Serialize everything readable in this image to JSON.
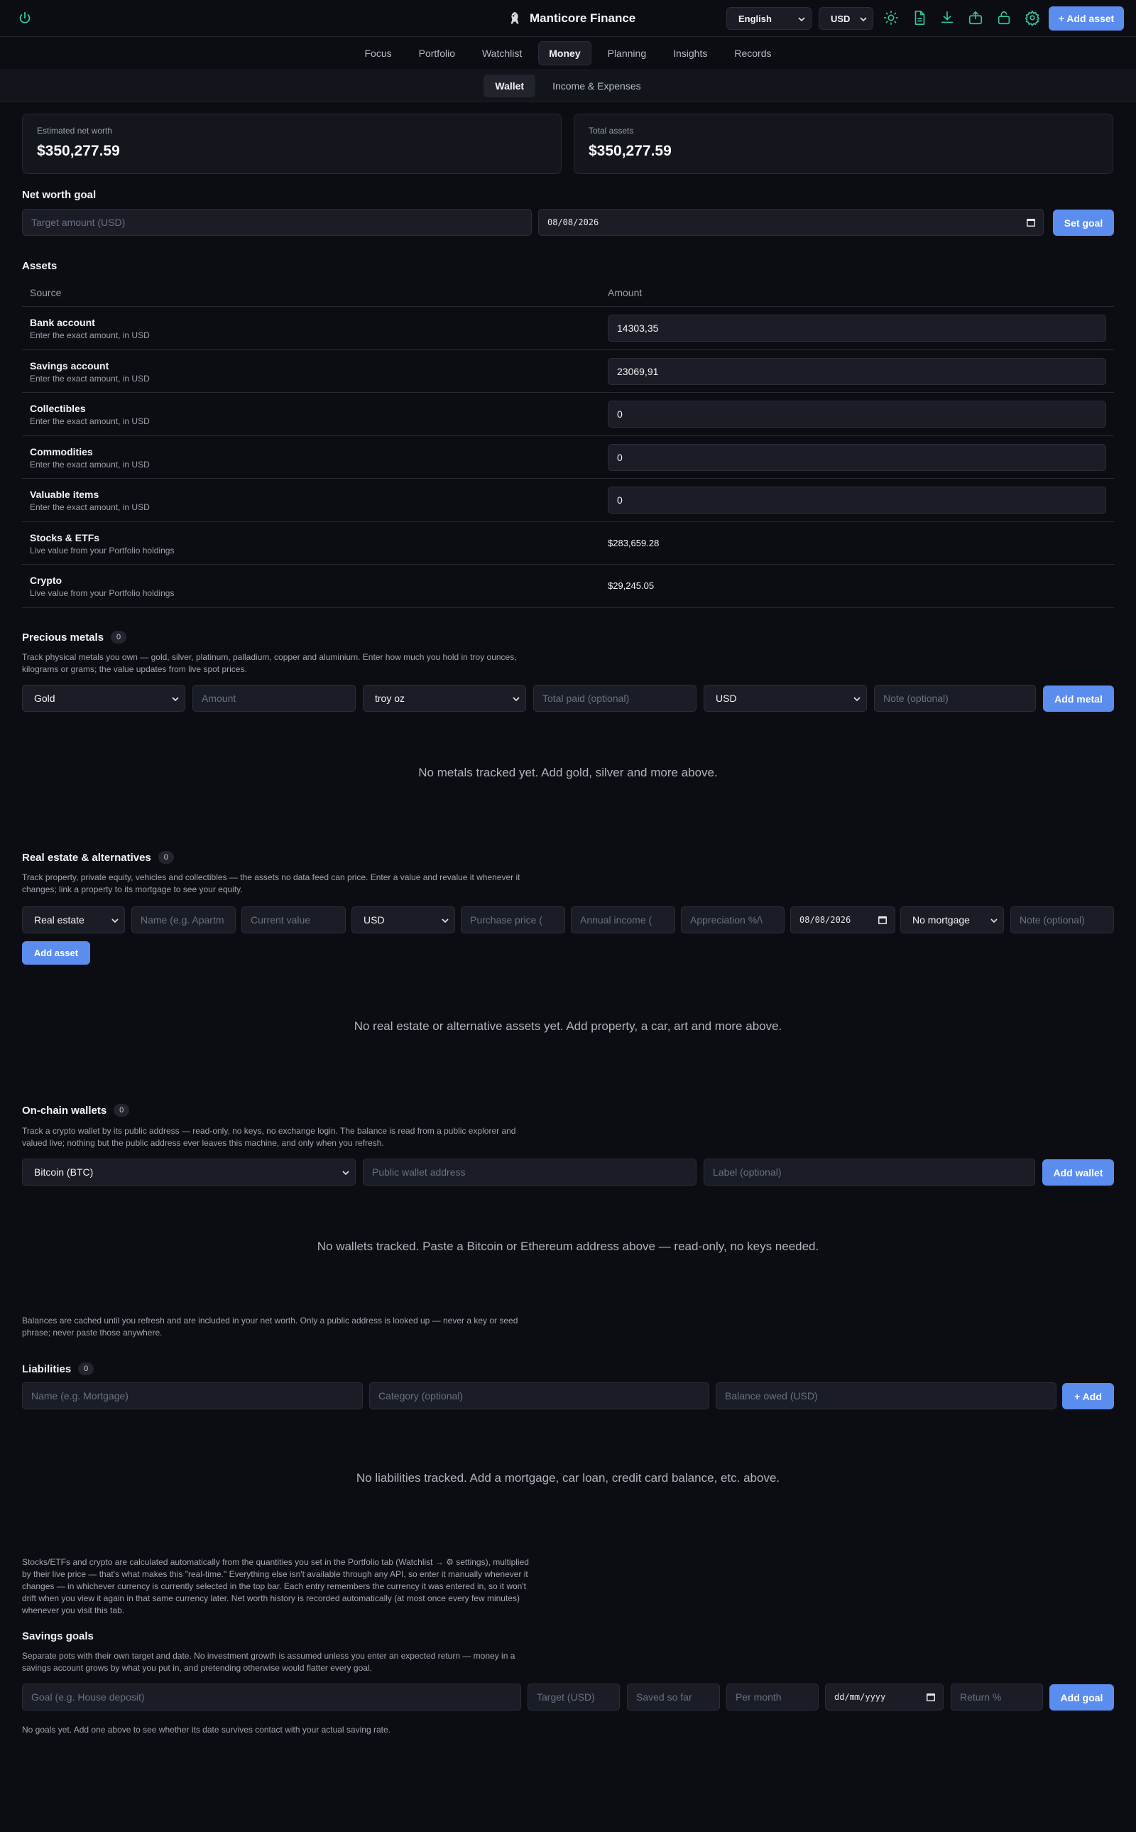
{
  "app": {
    "title": "Manticore Finance"
  },
  "topbar": {
    "language": "English",
    "currency": "USD",
    "add_asset_label": "+ Add asset",
    "icons": [
      "power-icon",
      "sun-icon",
      "document-icon",
      "download-icon",
      "upload-icon",
      "lock-icon",
      "gear-icon"
    ]
  },
  "nav": {
    "tabs": [
      "Focus",
      "Portfolio",
      "Watchlist",
      "Money",
      "Planning",
      "Insights",
      "Records"
    ],
    "active": "Money"
  },
  "subnav": {
    "tabs": [
      "Wallet",
      "Income & Expenses"
    ],
    "active": "Wallet"
  },
  "summary": {
    "net_worth_label": "Estimated net worth",
    "net_worth_value": "$350,277.59",
    "total_assets_label": "Total assets",
    "total_assets_value": "$350,277.59"
  },
  "goal": {
    "title": "Net worth goal",
    "target_placeholder": "Target amount (USD)",
    "date": "08/08/2026",
    "button": "Set goal"
  },
  "assets": {
    "title": "Assets",
    "col_source": "Source",
    "col_amount": "Amount",
    "rows": [
      {
        "name": "Bank account",
        "sub": "Enter the exact amount, in USD",
        "value": "14303,35"
      },
      {
        "name": "Savings account",
        "sub": "Enter the exact amount, in USD",
        "value": "23069,91"
      },
      {
        "name": "Collectibles",
        "sub": "Enter the exact amount, in USD",
        "value": "0"
      },
      {
        "name": "Commodities",
        "sub": "Enter the exact amount, in USD",
        "value": "0"
      },
      {
        "name": "Valuable items",
        "sub": "Enter the exact amount, in USD",
        "value": "0"
      },
      {
        "name": "Stocks & ETFs",
        "sub": "Live value from your Portfolio holdings",
        "value": "$283,659.28"
      },
      {
        "name": "Crypto",
        "sub": "Live value from your Portfolio holdings",
        "value": "$29,245.05"
      }
    ]
  },
  "metals": {
    "title": "Precious metals",
    "count": "0",
    "desc": "Track physical metals you own — gold, silver, platinum, palladium, copper and aluminium. Enter how much you hold in troy ounces, kilograms or grams; the value updates from live spot prices.",
    "metal": "Gold",
    "amount_placeholder": "Amount",
    "unit": "troy oz",
    "paid_placeholder": "Total paid (optional)",
    "currency": "USD",
    "note_placeholder": "Note (optional)",
    "button": "Add metal",
    "empty": "No metals tracked yet. Add gold, silver and more above."
  },
  "realestate": {
    "title": "Real estate & alternatives",
    "count": "0",
    "desc": "Track property, private equity, vehicles and collectibles — the assets no data feed can price. Enter a value and revalue it whenever it changes; link a property to its mortgage to see your equity.",
    "type": "Real estate",
    "name_placeholder": "Name (e.g. Apartm",
    "value_placeholder": "Current value",
    "currency": "USD",
    "purchase_placeholder": "Purchase price (",
    "income_placeholder": "Annual income (",
    "appreciation_placeholder": "Appreciation %/\\",
    "date": "08/08/2026",
    "mortgage": "No mortgage",
    "note_placeholder": "Note (optional)",
    "button": "Add asset",
    "empty": "No real estate or alternative assets yet. Add property, a car, art and more above."
  },
  "wallets": {
    "title": "On-chain wallets",
    "count": "0",
    "desc": "Track a crypto wallet by its public address — read-only, no keys, no exchange login. The balance is read from a public explorer and valued live; nothing but the public address ever leaves this machine, and only when you refresh.",
    "chain": "Bitcoin (BTC)",
    "address_placeholder": "Public wallet address",
    "label_placeholder": "Label (optional)",
    "button": "Add wallet",
    "empty": "No wallets tracked. Paste a Bitcoin or Ethereum address above — read-only, no keys needed.",
    "footnote": "Balances are cached until you refresh and are included in your net worth. Only a public address is looked up — never a key or seed phrase; never paste those anywhere."
  },
  "liabilities": {
    "title": "Liabilities",
    "count": "0",
    "name_placeholder": "Name (e.g. Mortgage)",
    "category_placeholder": "Category (optional)",
    "balance_placeholder": "Balance owed (USD)",
    "button": "+ Add",
    "empty": "No liabilities tracked. Add a mortgage, car loan, credit card balance, etc. above."
  },
  "note": "Stocks/ETFs and crypto are calculated automatically from the quantities you set in the Portfolio tab (Watchlist → ⚙ settings), multiplied by their live price — that's what makes this \"real-time.\" Everything else isn't available through any API, so enter it manually whenever it changes — in whichever currency is currently selected in the top bar. Each entry remembers the currency it was entered in, so it won't drift when you view it again in that same currency later. Net worth history is recorded automatically (at most once every few minutes) whenever you visit this tab.",
  "savings": {
    "title": "Savings goals",
    "desc": "Separate pots with their own target and date. No investment growth is assumed unless you enter an expected return — money in a savings account grows by what you put in, and pretending otherwise would flatter every goal.",
    "goal_placeholder": "Goal (e.g. House deposit)",
    "target_placeholder": "Target (USD)",
    "saved_placeholder": "Saved so far",
    "month_placeholder": "Per month",
    "date_placeholder": "dd/mm/yyyy",
    "return_placeholder": "Return %",
    "button": "Add goal",
    "empty": "No goals yet. Add one above to see whether its date survives contact with your actual saving rate."
  },
  "colors": {
    "accent": "#5b8def",
    "icon": "#2fc7a4",
    "bg": "#0c0d12"
  }
}
